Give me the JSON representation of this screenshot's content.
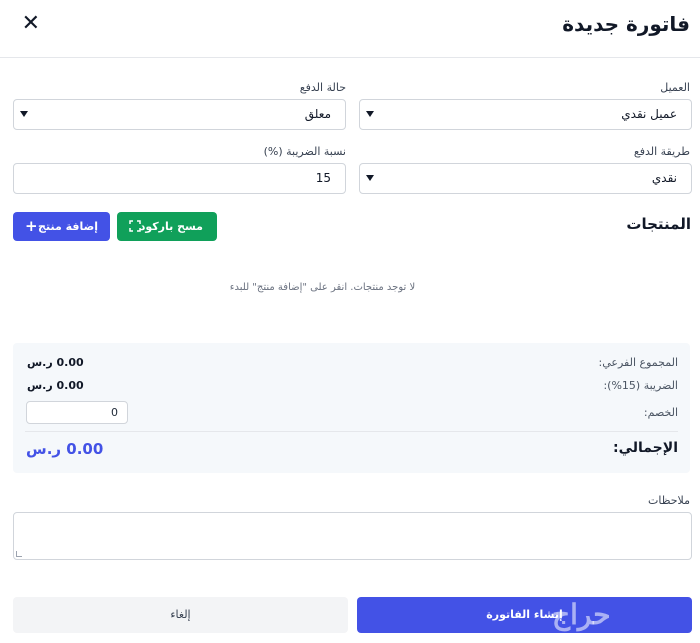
{
  "header": {
    "title": "فاتورة جديدة",
    "close_icon": "close-icon"
  },
  "form": {
    "customer_label": "العميل",
    "customer_value": "عميل نقدي",
    "payment_status_label": "حالة الدفع",
    "payment_status_value": "معلق",
    "payment_method_label": "طريقة الدفع",
    "payment_method_value": "نقدي",
    "tax_rate_label": "نسبة الضريبة (%)",
    "tax_rate_value": "15"
  },
  "products": {
    "title": "المنتجات",
    "add_button": "إضافة منتج",
    "add_icon": "+",
    "scan_button": "مسح باركود",
    "empty_message": "لا توجد منتجات. انقر على \"إضافة منتج\" للبدء"
  },
  "summary": {
    "subtotal_label": "المجموع الفرعي:",
    "subtotal_value": "0.00 ر.س",
    "tax_label": "الضريبة (15%):",
    "tax_value": "0.00 ر.س",
    "discount_label": "الخصم:",
    "discount_value": "0",
    "total_label": "الإجمالي:",
    "total_value": "0.00 ر.س"
  },
  "notes": {
    "label": "ملاحظات",
    "value": ""
  },
  "actions": {
    "create_label": "إنشاء الفاتورة",
    "cancel_label": "إلغاء"
  },
  "watermark": {
    "text": "حراج"
  },
  "colors": {
    "primary": "#4352e6",
    "success": "#10a05a",
    "summary_bg": "#f5f8fb"
  }
}
